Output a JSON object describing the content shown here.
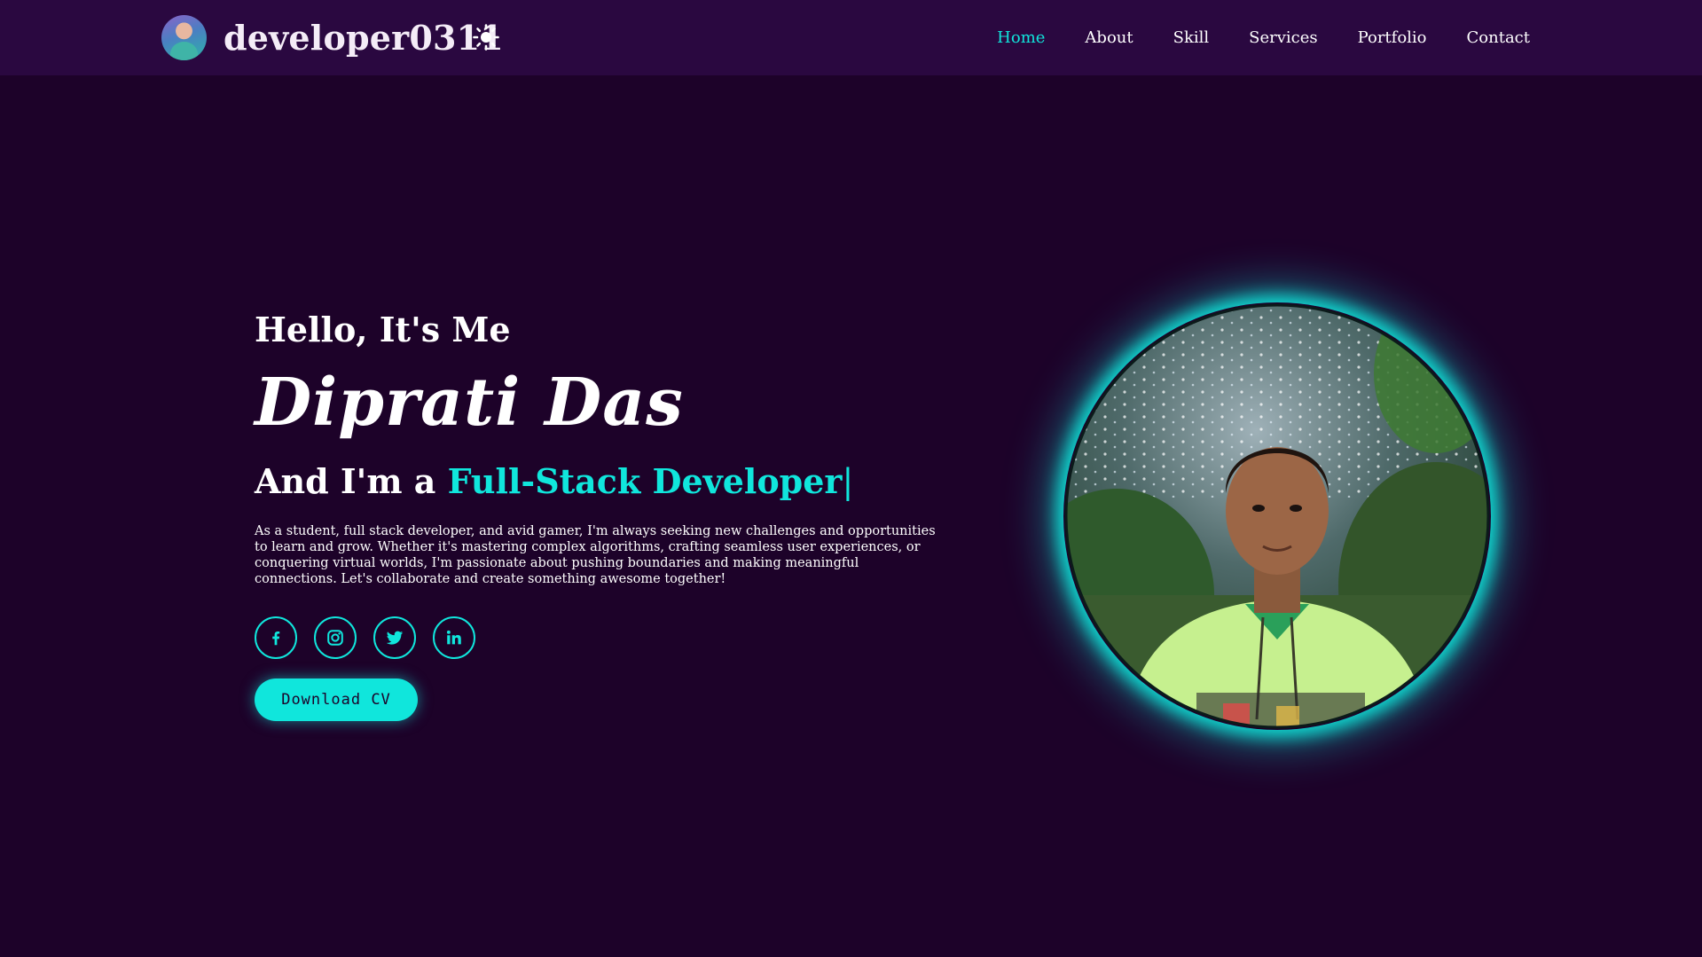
{
  "header": {
    "logo_text": "developer0311",
    "theme_toggle_icon": "sun-icon",
    "nav": [
      {
        "label": "Home",
        "active": true
      },
      {
        "label": "About",
        "active": false
      },
      {
        "label": "Skill",
        "active": false
      },
      {
        "label": "Services",
        "active": false
      },
      {
        "label": "Portfolio",
        "active": false
      },
      {
        "label": "Contact",
        "active": false
      }
    ]
  },
  "hero": {
    "greeting": "Hello, It's Me",
    "name": "Diprati Das",
    "role_prefix": "And I'm a ",
    "role_highlight": "Full-Stack Developer",
    "caret": "|",
    "bio": "As a student, full stack developer, and avid gamer, I'm always seeking new challenges and opportunities to learn and grow. Whether it's mastering complex algorithms, crafting seamless user experiences, or conquering virtual worlds, I'm passionate about pushing boundaries and making meaningful connections. Let's collaborate and create something awesome together!",
    "socials": [
      {
        "icon": "facebook-icon"
      },
      {
        "icon": "instagram-icon"
      },
      {
        "icon": "twitter-icon"
      },
      {
        "icon": "linkedin-icon"
      }
    ],
    "cv_button": "Download CV"
  },
  "colors": {
    "background": "#1d0229",
    "header_background": "#2a0840",
    "accent": "#10e6dc",
    "text": "#ffffff"
  }
}
